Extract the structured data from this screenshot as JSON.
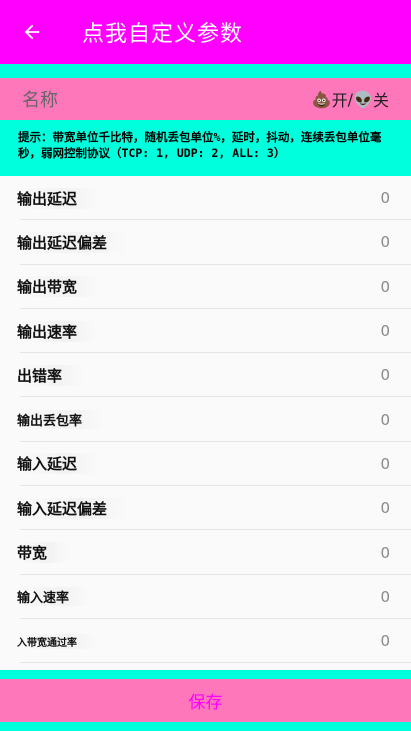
{
  "appbar": {
    "title": "点我自定义参数",
    "back_icon": "arrow-left-icon"
  },
  "name_bar": {
    "label": "名称",
    "on_label": "开",
    "off_label": "关",
    "separator": "/"
  },
  "hint": "提示：带宽单位千比特，随机丢包单位%，延时，抖动，连续丢包单位毫秒，弱网控制协议（TCP: 1, UDP: 2, ALL: 3）",
  "rows": [
    {
      "label": "输出延迟",
      "value": "0"
    },
    {
      "label": "输出延迟偏差",
      "value": "0"
    },
    {
      "label": "输出带宽",
      "value": "0"
    },
    {
      "label": "输出速率",
      "value": "0"
    },
    {
      "label": "出错率",
      "value": "0"
    },
    {
      "label": "输出丢包率",
      "value": "0"
    },
    {
      "label": "输入延迟",
      "value": "0"
    },
    {
      "label": "输入延迟偏差",
      "value": "0"
    },
    {
      "label": "带宽",
      "value": "0"
    },
    {
      "label": "输入速率",
      "value": "0"
    },
    {
      "label": "入带宽通过率",
      "value": "0"
    }
  ],
  "save": {
    "label": "保存"
  },
  "colors": {
    "magenta": "#ff00ff",
    "cyan": "#00ffdd",
    "pink": "#ff77bb"
  }
}
